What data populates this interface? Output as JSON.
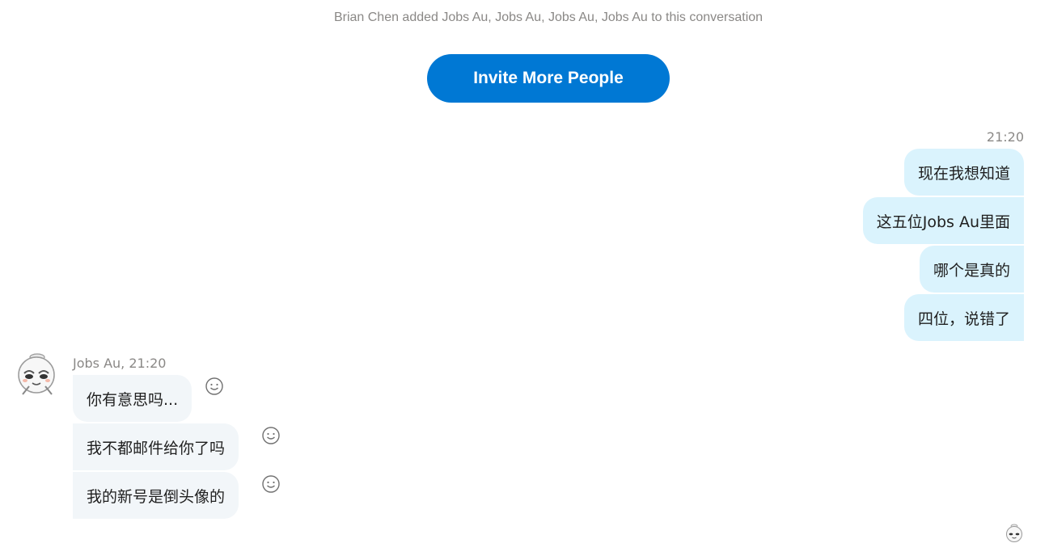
{
  "system_message": "Brian Chen added Jobs Au, Jobs Au, Jobs Au, Jobs Au to this conversation",
  "invite_button_label": "Invite More People",
  "outgoing": {
    "time": "21:20",
    "messages": [
      "现在我想知道",
      "这五位Jobs Au里面",
      "哪个是真的",
      "四位，说错了"
    ]
  },
  "incoming": {
    "sender_meta": "Jobs Au, 21:20",
    "messages": [
      "你有意思吗...",
      "我不都邮件给你了吗",
      "我的新号是倒头像的"
    ]
  },
  "colors": {
    "accent": "#0078d4",
    "outgoing_bubble": "#daf3fd",
    "incoming_bubble": "#f2f6f9",
    "muted_text": "#8a8886"
  },
  "icons": {
    "avatar": "cartoon-avatar-icon",
    "reaction": "smiley-face-icon",
    "read_receipt": "read-receipt-avatar-icon"
  }
}
